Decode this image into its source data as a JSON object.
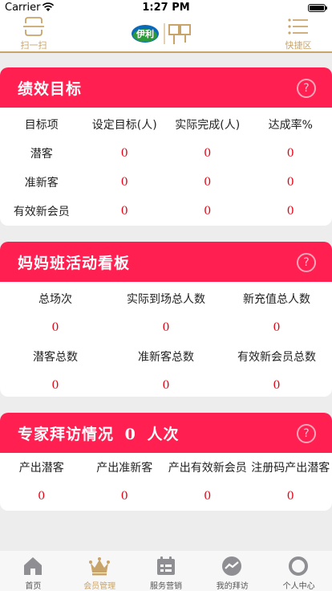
{
  "status": {
    "carrier": "Carrier",
    "time": "1:27 PM"
  },
  "nav": {
    "scan_label": "扫一扫",
    "shortcut_label": "快捷区",
    "logo_text": "伊利"
  },
  "performance": {
    "title": "绩效目标",
    "headers": [
      "目标项",
      "设定目标(人)",
      "实际完成(人)",
      "达成率%"
    ],
    "rows": [
      {
        "label": "潜客",
        "target": "0",
        "actual": "0",
        "rate": "0"
      },
      {
        "label": "准新客",
        "target": "0",
        "actual": "0",
        "rate": "0"
      },
      {
        "label": "有效新会员",
        "target": "0",
        "actual": "0",
        "rate": "0"
      }
    ]
  },
  "mom_class": {
    "title": "妈妈班活动看板",
    "row1_labels": [
      "总场次",
      "实际到场总人数",
      "新充值总人数"
    ],
    "row1_values": [
      "0",
      "0",
      "0"
    ],
    "row2_labels": [
      "潜客总数",
      "准新客总数",
      "有效新会员总数"
    ],
    "row2_values": [
      "0",
      "0",
      "0"
    ]
  },
  "expert": {
    "title_prefix": "专家拜访情况",
    "count": "0",
    "title_suffix": "人次",
    "labels": [
      "产出潜客",
      "产出准新客",
      "产出有效新会员",
      "注册码产出潜客"
    ],
    "values": [
      "0",
      "0",
      "0",
      "0"
    ]
  },
  "tabs": [
    {
      "label": "首页",
      "icon": "home-icon"
    },
    {
      "label": "会员管理",
      "icon": "crown-icon",
      "active": true
    },
    {
      "label": "服务营销",
      "icon": "calendar-icon"
    },
    {
      "label": "我的拜访",
      "icon": "trend-icon"
    },
    {
      "label": "个人中心",
      "icon": "profile-icon"
    }
  ],
  "colors": {
    "header_red": "#ff1f50",
    "gold": "#c9a46a",
    "value_red": "#e60012"
  }
}
